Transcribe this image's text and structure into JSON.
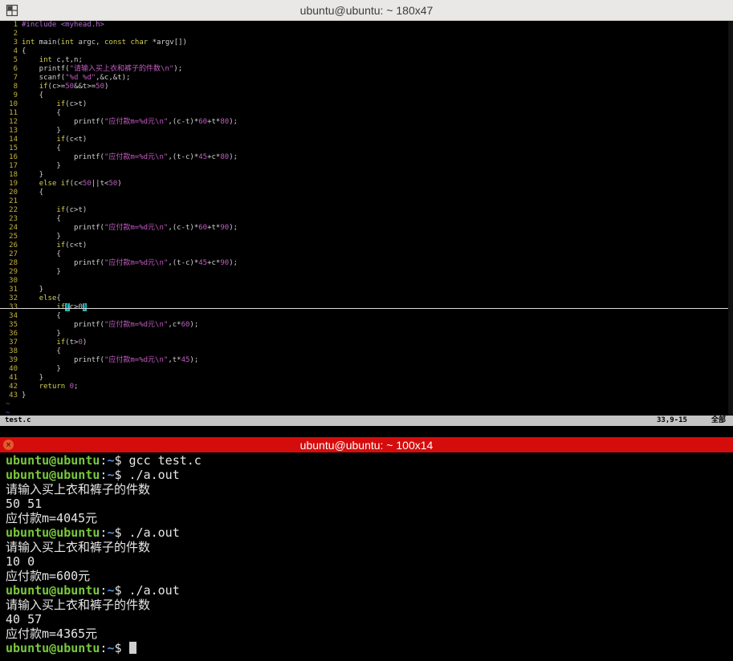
{
  "top_window": {
    "title": "ubuntu@ubuntu: ~ 180x47",
    "editor": {
      "lines": [
        [
          {
            "t": "#include <myhead.h>",
            "c": "pp"
          }
        ],
        [],
        [
          {
            "t": "int",
            "c": "kw"
          },
          {
            "t": " main("
          },
          {
            "t": "int",
            "c": "kw"
          },
          {
            "t": " argc, "
          },
          {
            "t": "const",
            "c": "kw"
          },
          {
            "t": " "
          },
          {
            "t": "char",
            "c": "kw"
          },
          {
            "t": " *argv[])"
          }
        ],
        [
          {
            "t": "{"
          }
        ],
        [
          {
            "t": "    "
          },
          {
            "t": "int",
            "c": "kw"
          },
          {
            "t": " c,t,n;"
          }
        ],
        [
          {
            "t": "    printf("
          },
          {
            "t": "\"请输入买上衣和裤子的件数\\n\"",
            "c": "str"
          },
          {
            "t": ");"
          }
        ],
        [
          {
            "t": "    scanf("
          },
          {
            "t": "\"%d %d\"",
            "c": "str"
          },
          {
            "t": ",&c,&t);"
          }
        ],
        [
          {
            "t": "    "
          },
          {
            "t": "if",
            "c": "kw"
          },
          {
            "t": "(c>="
          },
          {
            "t": "50",
            "c": "num"
          },
          {
            "t": "&&t>="
          },
          {
            "t": "50",
            "c": "num"
          },
          {
            "t": ")"
          }
        ],
        [
          {
            "t": "    {"
          }
        ],
        [
          {
            "t": "        "
          },
          {
            "t": "if",
            "c": "kw"
          },
          {
            "t": "(c>t)"
          }
        ],
        [
          {
            "t": "        {"
          }
        ],
        [
          {
            "t": "            printf("
          },
          {
            "t": "\"应付款m=%d元\\n\"",
            "c": "str"
          },
          {
            "t": ",(c-t)*"
          },
          {
            "t": "60",
            "c": "num"
          },
          {
            "t": "+t*"
          },
          {
            "t": "80",
            "c": "num"
          },
          {
            "t": ");"
          }
        ],
        [
          {
            "t": "        }"
          }
        ],
        [
          {
            "t": "        "
          },
          {
            "t": "if",
            "c": "kw"
          },
          {
            "t": "(c<t)"
          }
        ],
        [
          {
            "t": "        {"
          }
        ],
        [
          {
            "t": "            printf("
          },
          {
            "t": "\"应付款m=%d元\\n\"",
            "c": "str"
          },
          {
            "t": ",(t-c)*"
          },
          {
            "t": "45",
            "c": "num"
          },
          {
            "t": "+c*"
          },
          {
            "t": "80",
            "c": "num"
          },
          {
            "t": ");"
          }
        ],
        [
          {
            "t": "        }"
          }
        ],
        [
          {
            "t": "    }"
          }
        ],
        [
          {
            "t": "    "
          },
          {
            "t": "else",
            "c": "kw"
          },
          {
            "t": " "
          },
          {
            "t": "if",
            "c": "kw"
          },
          {
            "t": "(c<"
          },
          {
            "t": "50",
            "c": "num"
          },
          {
            "t": "||t<"
          },
          {
            "t": "50",
            "c": "num"
          },
          {
            "t": ")"
          }
        ],
        [
          {
            "t": "    {"
          }
        ],
        [],
        [
          {
            "t": "        "
          },
          {
            "t": "if",
            "c": "kw"
          },
          {
            "t": "(c>t)"
          }
        ],
        [
          {
            "t": "        {"
          }
        ],
        [
          {
            "t": "            printf("
          },
          {
            "t": "\"应付款m=%d元\\n\"",
            "c": "str"
          },
          {
            "t": ",(c-t)*"
          },
          {
            "t": "60",
            "c": "num"
          },
          {
            "t": "+t*"
          },
          {
            "t": "90",
            "c": "num"
          },
          {
            "t": ");"
          }
        ],
        [
          {
            "t": "        }"
          }
        ],
        [
          {
            "t": "        "
          },
          {
            "t": "if",
            "c": "kw"
          },
          {
            "t": "(c<t)"
          }
        ],
        [
          {
            "t": "        {"
          }
        ],
        [
          {
            "t": "            printf("
          },
          {
            "t": "\"应付款m=%d元\\n\"",
            "c": "str"
          },
          {
            "t": ",(t-c)*"
          },
          {
            "t": "45",
            "c": "num"
          },
          {
            "t": "+c*"
          },
          {
            "t": "90",
            "c": "num"
          },
          {
            "t": ");"
          }
        ],
        [
          {
            "t": "        }"
          }
        ],
        [],
        [
          {
            "t": "    }"
          }
        ],
        [
          {
            "t": "    "
          },
          {
            "t": "else",
            "c": "kw"
          },
          {
            "t": "{"
          }
        ],
        [
          {
            "t": "        "
          },
          {
            "t": "if",
            "c": "kw"
          },
          {
            "t": "(",
            "c": "cursor-cell"
          },
          {
            "t": "c>0"
          },
          {
            "t": ")",
            "c": "cursor-cell"
          }
        ],
        [
          {
            "t": "        {"
          }
        ],
        [
          {
            "t": "            printf("
          },
          {
            "t": "\"应付款m=%d元\\n\"",
            "c": "str"
          },
          {
            "t": ",c*"
          },
          {
            "t": "60",
            "c": "num"
          },
          {
            "t": ");"
          }
        ],
        [
          {
            "t": "        }"
          }
        ],
        [
          {
            "t": "        "
          },
          {
            "t": "if",
            "c": "kw"
          },
          {
            "t": "(t>"
          },
          {
            "t": "0",
            "c": "num"
          },
          {
            "t": ")"
          }
        ],
        [
          {
            "t": "        {"
          }
        ],
        [
          {
            "t": "            printf("
          },
          {
            "t": "\"应付款m=%d元\\n\"",
            "c": "str"
          },
          {
            "t": ",t*"
          },
          {
            "t": "45",
            "c": "num"
          },
          {
            "t": ");"
          }
        ],
        [
          {
            "t": "        }"
          }
        ],
        [
          {
            "t": "    }"
          }
        ],
        [
          {
            "t": "    "
          },
          {
            "t": "return",
            "c": "kw"
          },
          {
            "t": " "
          },
          {
            "t": "0",
            "c": "num"
          },
          {
            "t": ";"
          }
        ],
        [
          {
            "t": "}"
          }
        ]
      ],
      "tilde_lines": [
        "~",
        "~"
      ]
    },
    "status": {
      "filename": "test.c",
      "position": "33,9-15",
      "percent": "全部"
    }
  },
  "bottom_window": {
    "title": "ubuntu@ubuntu: ~ 100x14",
    "close_glyph": "×",
    "prompt": {
      "user": "ubuntu@ubuntu",
      "sep": ":",
      "path": "~",
      "symbol": "$ "
    },
    "lines": [
      {
        "type": "cmd",
        "text": "gcc test.c"
      },
      {
        "type": "cmd",
        "text": "./a.out"
      },
      {
        "type": "out",
        "text": "请输入买上衣和裤子的件数"
      },
      {
        "type": "out",
        "text": "50 51"
      },
      {
        "type": "out",
        "text": "应付款m=4045元"
      },
      {
        "type": "cmd",
        "text": "./a.out"
      },
      {
        "type": "out",
        "text": "请输入买上衣和裤子的件数"
      },
      {
        "type": "out",
        "text": "10 0"
      },
      {
        "type": "out",
        "text": "应付款m=600元"
      },
      {
        "type": "cmd",
        "text": "./a.out"
      },
      {
        "type": "out",
        "text": "请输入买上衣和裤子的件数"
      },
      {
        "type": "out",
        "text": "40 57"
      },
      {
        "type": "out",
        "text": "应付款m=4365元"
      },
      {
        "type": "cmd",
        "text": "",
        "cursor": true
      }
    ]
  },
  "colors": {
    "top_titlebar": "#e9e8e6",
    "bottom_titlebar": "#d50c0c",
    "prompt_user": "#78c83c",
    "prompt_path": "#5a8fd8",
    "line_number": "#c8b23d",
    "keyword": "#d4d050",
    "string": "#c25cc2",
    "vim_cursor": "#1dbdbd"
  }
}
